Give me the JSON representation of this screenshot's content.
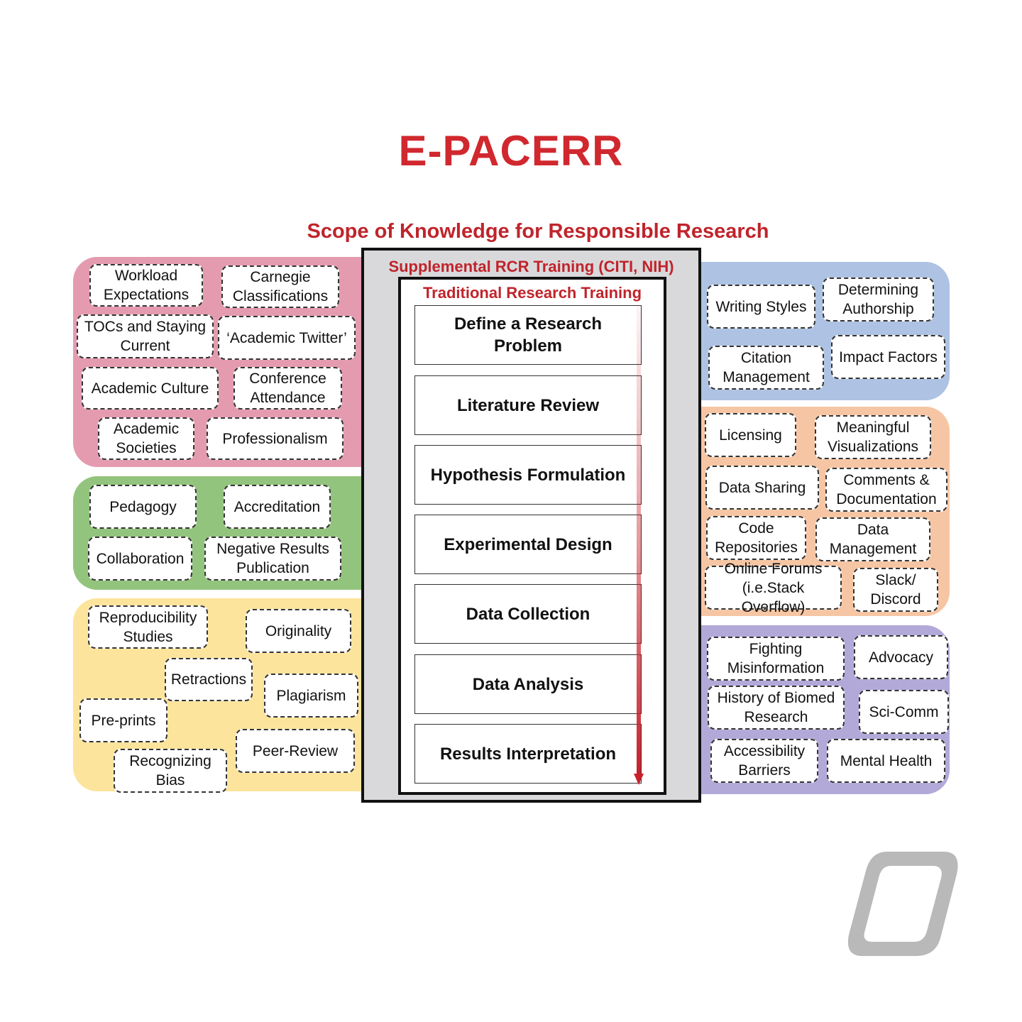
{
  "title": "E-PACERR",
  "subtitle": "Scope of Knowledge for Responsible Research",
  "center": {
    "outer_label": "Supplemental RCR Training (CITI, NIH)",
    "inner_label": "Traditional Research Training",
    "steps": [
      "Define a Research Problem",
      "Literature Review",
      "Hypothesis Formulation",
      "Experimental Design",
      "Data Collection",
      "Data Analysis",
      "Results Interpretation"
    ],
    "arrow_color": "#c8202a"
  },
  "regions": {
    "pink": {
      "color": "#e49bb0",
      "items": [
        "Workload Expectations",
        "Carnegie Classifications",
        "TOCs and Staying Current",
        "‘Academic Twitter’",
        "Academic Culture",
        "Conference Attendance",
        "Academic Societies",
        "Professionalism"
      ]
    },
    "green": {
      "color": "#93c47d",
      "items": [
        "Pedagogy",
        "Accreditation",
        "Collaboration",
        "Negative Results Publication"
      ]
    },
    "yellow": {
      "color": "#fde49c",
      "items": [
        "Reproducibility Studies",
        "Originality",
        "Retractions",
        "Plagiarism",
        "Pre-prints",
        "Peer-Review",
        "Recognizing Bias"
      ]
    },
    "blue": {
      "color": "#aec3e3",
      "items": [
        "Writing Styles",
        "Determining Authorship",
        "Citation Management",
        "Impact Factors"
      ]
    },
    "orange": {
      "color": "#f6c6a4",
      "items": [
        "Licensing",
        "Meaningful Visualizations",
        "Data Sharing",
        "Comments & Documentation",
        "Code Repositories",
        "Data Management",
        "Online Forums (i.e.Stack Overflow)",
        "Slack/ Discord"
      ]
    },
    "purple": {
      "color": "#b3a9d9",
      "items": [
        "Fighting Misinformation",
        "Advocacy",
        "History of Biomed Research",
        "Sci-Comm",
        "Accessibility Barriers",
        "Mental Health"
      ]
    }
  },
  "logo": {
    "icon": "university-o-logo",
    "color": "#b9b9b9"
  }
}
